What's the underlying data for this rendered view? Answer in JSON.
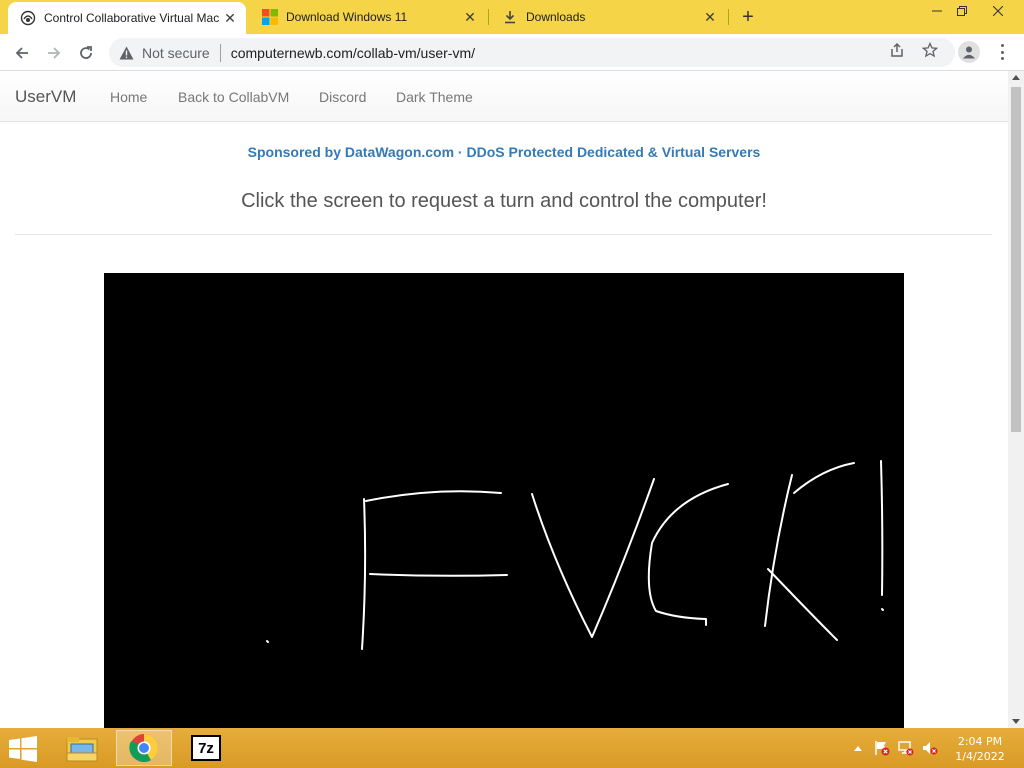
{
  "browser": {
    "tabs": [
      {
        "title": "Control Collaborative Virtual Mac",
        "active": true
      },
      {
        "title": "Download Windows 11",
        "active": false
      },
      {
        "title": "Downloads",
        "active": false
      }
    ],
    "new_tab_label": "+",
    "security_label": "Not secure",
    "url": "computernewb.com/collab-vm/user-vm/"
  },
  "site": {
    "brand": "UserVM",
    "nav": [
      "Home",
      "Back to CollabVM",
      "Discord",
      "Dark Theme"
    ],
    "sponsor": "Sponsored by DataWagon.com · DDoS Protected Dedicated & Virtual Servers",
    "prompt": "Click the screen to request a turn and control the computer!"
  },
  "taskbar": {
    "clock_time": "2:04 PM",
    "clock_date": "1/4/2022",
    "apps": [
      "file-explorer",
      "chrome",
      "7zip"
    ],
    "seven_zip_label": "7z"
  },
  "colors": {
    "titlebar": "#f5d547",
    "taskbar": "#d99a25",
    "link": "#337ab7",
    "vm_screen": "#000000"
  }
}
